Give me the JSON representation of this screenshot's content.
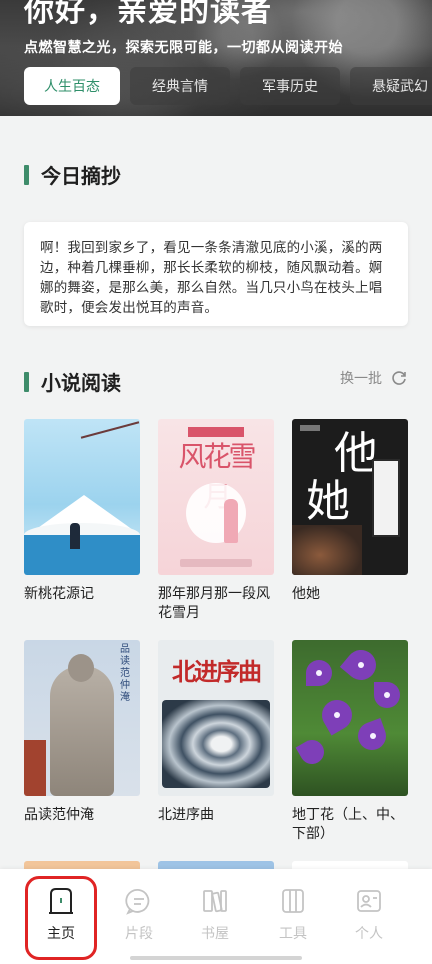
{
  "hero": {
    "title": "你好，亲爱的读者",
    "subtitle": "点燃智慧之光，探索无限可能，一切都从阅读开始"
  },
  "tabs": [
    {
      "label": "人生百态",
      "active": true
    },
    {
      "label": "经典言情",
      "active": false
    },
    {
      "label": "军事历史",
      "active": false
    },
    {
      "label": "悬疑武幻",
      "active": false
    }
  ],
  "daily": {
    "title": "今日摘抄",
    "quote": "啊！我回到家乡了，看见一条条清澈见底的小溪，溪的两边，种着几棵垂柳，那长长柔软的柳枝，随风飘动着。婀娜的舞姿，是那么美，那么自然。当几只小鸟在枝头上唱歌时，便会发出悦耳的声音。"
  },
  "novels": {
    "title": "小说阅读",
    "refresh_label": "换一批",
    "books": [
      {
        "title": "新桃花源记"
      },
      {
        "title": "那年那月那一段风花雪月",
        "cover_title": "风花雪月"
      },
      {
        "title": "他她",
        "cover_title_1": "他",
        "cover_title_2": "她"
      },
      {
        "title": "品读范仲淹",
        "cover_vertical_text": "品读范仲淹"
      },
      {
        "title": "北进序曲",
        "cover_title": "北进序曲"
      },
      {
        "title": "地丁花（上、中、下部）"
      }
    ]
  },
  "bottom_nav": [
    {
      "label": "主页",
      "icon": "home-icon",
      "active": true
    },
    {
      "label": "片段",
      "icon": "chat-icon",
      "active": false
    },
    {
      "label": "书屋",
      "icon": "bookshelf-icon",
      "active": false
    },
    {
      "label": "工具",
      "icon": "tools-icon",
      "active": false
    },
    {
      "label": "个人",
      "icon": "profile-icon",
      "active": false
    }
  ],
  "colors": {
    "accent": "#3e8c6a",
    "highlight": "#e02424",
    "inactive_nav": "#c4c4c4"
  }
}
